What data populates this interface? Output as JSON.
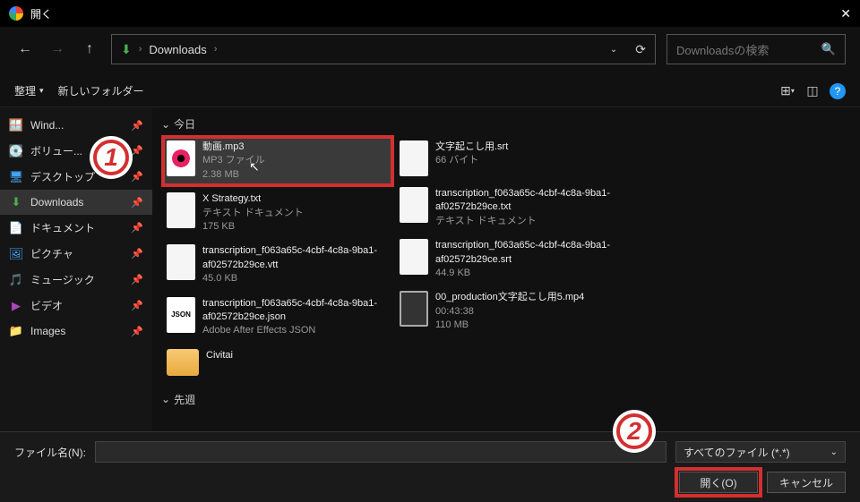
{
  "window": {
    "title": "開く"
  },
  "nav": {
    "crumb": "Downloads",
    "search_placeholder": "Downloadsの検索"
  },
  "toolbar": {
    "organize": "整理",
    "new_folder": "新しいフォルダー"
  },
  "sidebar": {
    "items": [
      {
        "icon": "🪟",
        "label": "Wind...",
        "cls": "c-blue"
      },
      {
        "icon": "💽",
        "label": "ボリュー...",
        "cls": ""
      },
      {
        "icon": "🖥",
        "label": "デスクトップ",
        "cls": "c-blue"
      },
      {
        "icon": "⬇",
        "label": "Downloads",
        "cls": "c-green",
        "active": true
      },
      {
        "icon": "📄",
        "label": "ドキュメント",
        "cls": ""
      },
      {
        "icon": "🖼",
        "label": "ピクチャ",
        "cls": "c-blue"
      },
      {
        "icon": "🎵",
        "label": "ミュージック",
        "cls": "c-pink"
      },
      {
        "icon": "▶",
        "label": "ビデオ",
        "cls": "c-purple"
      },
      {
        "icon": "📁",
        "label": "Images",
        "cls": "c-orange"
      }
    ]
  },
  "groups": {
    "today": "今日",
    "lastweek": "先週"
  },
  "files": {
    "col1": [
      {
        "name": "動画.mp3",
        "sub1": "MP3 ファイル",
        "sub2": "2.38 MB",
        "thumb": "mp3",
        "selected": true
      },
      {
        "name": "X Strategy.txt",
        "sub1": "テキスト ドキュメント",
        "sub2": "175 KB",
        "thumb": "doc"
      },
      {
        "name": "transcription_f063a65c-4cbf-4c8a-9ba1-af02572b29ce.vtt",
        "sub1": "45.0 KB",
        "sub2": "",
        "thumb": "doc"
      },
      {
        "name": "transcription_f063a65c-4cbf-4c8a-9ba1-af02572b29ce.json",
        "sub1": "Adobe After Effects JSON",
        "sub2": "",
        "thumb": "json"
      },
      {
        "name": "Civitai",
        "sub1": "",
        "sub2": "",
        "thumb": "folder"
      }
    ],
    "col2": [
      {
        "name": "文字起こし用.srt",
        "sub1": "66 バイト",
        "sub2": "",
        "thumb": "doc"
      },
      {
        "name": "transcription_f063a65c-4cbf-4c8a-9ba1-af02572b29ce.txt",
        "sub1": "テキスト ドキュメント",
        "sub2": "",
        "thumb": "doc"
      },
      {
        "name": "transcription_f063a65c-4cbf-4c8a-9ba1-af02572b29ce.srt",
        "sub1": "44.9 KB",
        "sub2": "",
        "thumb": "doc"
      },
      {
        "name": "00_production文字起こし用5.mp4",
        "sub1": "00:43:38",
        "sub2": "110 MB",
        "thumb": "video"
      }
    ]
  },
  "footer": {
    "filename_label": "ファイル名(N):",
    "filter": "すべてのファイル (*.*)",
    "open": "開く(O)",
    "cancel": "キャンセル"
  },
  "badges": {
    "one": "1",
    "two": "2"
  }
}
